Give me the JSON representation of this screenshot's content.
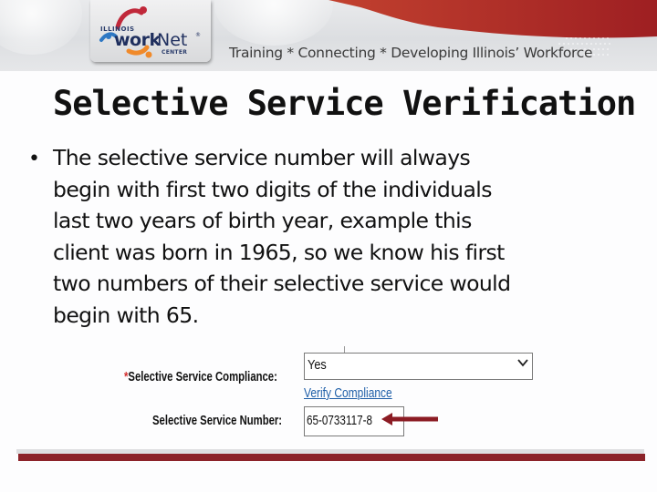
{
  "header": {
    "logo": {
      "state_text": "ILLINOIS",
      "brand_bold": "work",
      "brand_light": "Net",
      "registered": "®",
      "subtext": "CENTER"
    },
    "tagline": "Training * Connecting * Developing Illinois’ Workforce",
    "colors": {
      "accent_red": "#a62428",
      "banner_grey": "#e0e1e3"
    }
  },
  "slide": {
    "title": "Selective Service Verification",
    "bullet": "•",
    "body_lines": [
      "The selective service number will always",
      "begin with first two digits of the individuals",
      "last two years of birth year, example this",
      "client was born in 1965, so we know his first",
      "two numbers of their selective service would",
      "begin with 65."
    ]
  },
  "form": {
    "compliance_required_marker": "*",
    "compliance_label": "Selective Service Compliance:",
    "compliance_value": "Yes",
    "verify_link": "Verify Compliance",
    "number_label": "Selective Service Number:",
    "number_value": "65-0733117-8",
    "colors": {
      "link": "#1f5fa8",
      "required": "#d32f2f",
      "arrow": "#8c1c24"
    }
  },
  "footer": {
    "colors": {
      "bar_grey": "#dedfe1",
      "bar_red": "#8c2329"
    }
  }
}
